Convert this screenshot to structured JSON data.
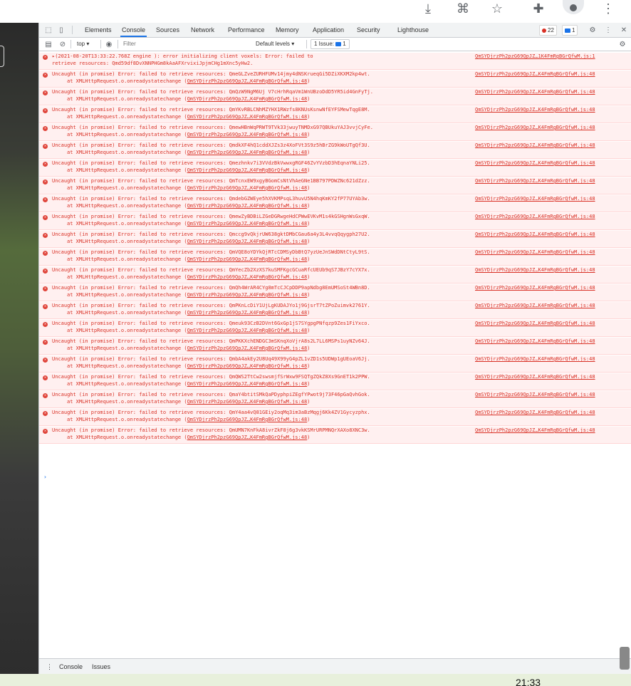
{
  "devtools": {
    "tabs": [
      "Elements",
      "Console",
      "Sources",
      "Network",
      "Performance",
      "Memory",
      "Application",
      "Security",
      "Lighthouse"
    ],
    "active_tab": "Console",
    "error_count": "22",
    "message_count": "1"
  },
  "toolbar": {
    "context": "top",
    "filter_placeholder": "Filter",
    "levels_label": "Default levels",
    "issues_label": "1 Issue:",
    "issues_count": "1"
  },
  "console": {
    "first_entry": {
      "line1": "▸(2021-08-20T13:33:22.768Z                engine          ): error initializing client voxels: Error: failed to",
      "line2": "retrieve resources: Qmd59df8DvXNNPHGm8kAaAFXrvixiJpjmCHg1mXnc5yHw2.",
      "source": "QmSYDjrzPh2pzG69QpJZ…1K4FmRgBGrQfwM.js:1"
    },
    "message_prefix": "Uncaught (in promise) Error: failed to retrieve resources: ",
    "stack_prefix": "at XMLHttpRequest.o.onreadystatechange (",
    "stack_link": "QmSYDjrzPh2pzG69QpJZ…K4FmRgBGrQfwM.js:48",
    "stack_suffix": ")",
    "source_link": "QmSYDjrzPh2pzG69QpJZ…K4FmRgBGrQfwM.js:48",
    "errors": [
      "QmeGLZveZURHFUMv14jmy4dNSKrueqGi5DZiXKXM2kp4wt.",
      "QmQzW9NgM6Uj V7cHrhRqaVm1WnUBzoDdD5YR5id4GnFyTj.",
      "QmYKvRBLCNhMZYHX1RWzfs8KNUsKsnwNfEYFSMewTqgE8M.",
      "QmewHBnWqPRWT9TVk33jwuyTNMDxG97QBUkuYAJ3vvjCyFe.",
      "QmdkXF4hQ1cddXJZs3z4XoFVt3S9z5hBrZG9kWoUTgQf3U.",
      "Qmezhnkv7i3VVdzBkVwwxgRGF46ZvYVzbD3hEqnaYNLi25.",
      "QmTcnxEW9xgyBGomCsNtVhAeGNe1BB797PDWZNc621dZzz.",
      "QmdebGZWEye5hXVKMPsqL3huvU5N4hqKmKY2fP77UYAb3w.",
      "QmewZyBDBiLZGeDGRwgeHdCPWwEVKvM1s4kGSHgnWsGxqW.",
      "Qmccg9vQkjrUW638gktDMbCGau6a4y3L4vvqQqygph27U2.",
      "QmVQE8oYDYkQjRTcCDMSyDbBtQ7yzUeJnSWdDNtCtyL9tS.",
      "QmYecZb2XzXS7kuSMFKgcGCuaRfcUEUb9qS7JBzY7cYX7x.",
      "QmQh4WrAR4CYg8mTcCJCpDDP9apNdbg8EmUMSoSt4WBn8D.",
      "QmPKnLcDiY1UjLgKUDAJYo1j9GjsrT7tZPoZuimvk2761Y.",
      "Qmeuk93CzB2DVnt6GxGp1jS7SYgpgPNfqzp9Zes1FiYxco.",
      "QmPKKXchENDGC3mSKnqXoVjrA8s2L7LL6MSPs1uyNZv64J.",
      "QmbA4akEy2U8Uq49X99yG4pZL1vZD1s5UDWp1gUEoaV6Jj.",
      "QmQWS2TtCw2swsmjfSrWxw9FSQTgZQkZ8Xs9GnET1k2PPW.",
      "QmaY4btitSMkQaPDyphpiZEgfYPwot9j73F46pGaQvhGok.",
      "QmY4aa4vQ81GEiy2oqMq3im3aBzMqgj6Kk4ZV1Gycyzphx.",
      "QmUMN7KnFkA8ivrZkF8j6g3vkKSMrURPMNQrXAXo8XNC3w."
    ]
  },
  "drawer": {
    "tabs": [
      "Console",
      "Issues"
    ]
  },
  "taskbar": {
    "clock": "21:33"
  }
}
